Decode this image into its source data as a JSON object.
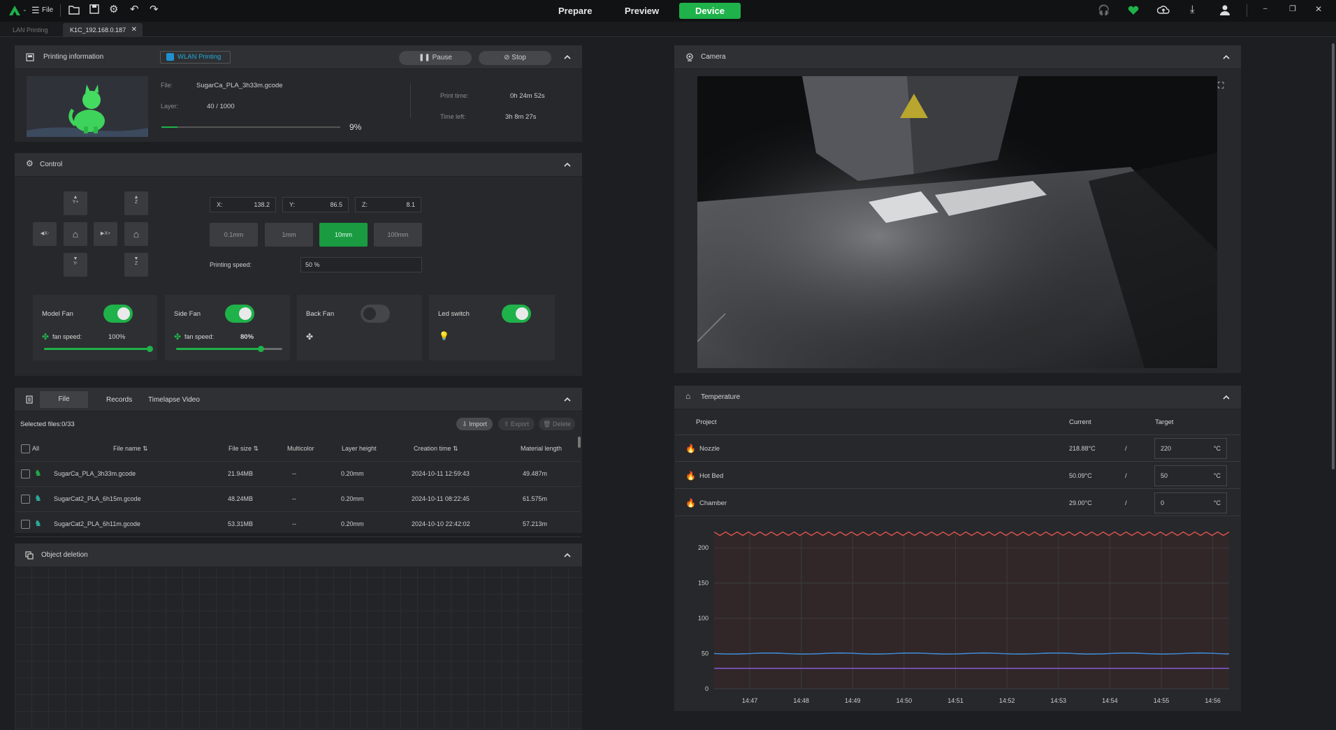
{
  "menubar": {
    "file_label": "File",
    "tabs": [
      "Prepare",
      "Preview",
      "Device"
    ],
    "active_tab": "Device"
  },
  "tabs": {
    "lan": "LAN Printing",
    "device": "K1C_192.168.0.187"
  },
  "print_info": {
    "title": "Printing information",
    "mode": "WLAN Printing",
    "pause": "Pause",
    "stop": "Stop",
    "file_label": "File:",
    "file_value": "SugarCa_PLA_3h33m.gcode",
    "layer_label": "Layer:",
    "layer_value": "40 / 1000",
    "progress": 0.09,
    "progress_text": "9%",
    "print_time_label": "Print time:",
    "print_time_value": "0h 24m 52s",
    "time_left_label": "Time left:",
    "time_left_value": "3h 8m 27s"
  },
  "control": {
    "title": "Control",
    "jog": {
      "yplus": "Y+",
      "yminus": "Y-",
      "xminus": "X-",
      "xplus": "X+",
      "zup": "Z",
      "zdown": "Z"
    },
    "x_label": "X:",
    "x_value": "138.2",
    "y_label": "Y:",
    "y_value": "86.5",
    "z_label": "Z:",
    "z_value": "8.1",
    "steps": [
      "0.1mm",
      "1mm",
      "10mm",
      "100mm"
    ],
    "active_step": "10mm",
    "speed_label": "Printing speed:",
    "speed_value": "50 %"
  },
  "fans": {
    "model_fan": {
      "label": "Model Fan",
      "on": true,
      "speed_label": "fan speed:",
      "speed": "100%",
      "level": 1.0
    },
    "side_fan": {
      "label": "Side Fan",
      "on": true,
      "speed_label": "fan speed:",
      "speed": "80%",
      "level": 0.8
    },
    "back_fan": {
      "label": "Back Fan",
      "on": false
    },
    "led": {
      "label": "Led switch",
      "on": true
    }
  },
  "files": {
    "tabs": [
      "File",
      "Records",
      "Timelapse Video"
    ],
    "active_tab": "File",
    "selected": "Selected files:0/33",
    "import": "Import",
    "export": "Export",
    "delete": "Delete",
    "columns": {
      "all": "All",
      "name": "File name",
      "size": "File size",
      "multicolor": "Multicolor",
      "layer_height": "Layer height",
      "created": "Creation time",
      "material": "Material length"
    },
    "rows": [
      {
        "name": "SugarCa_PLA_3h33m.gcode",
        "size": "21.94MB",
        "multicolor": "--",
        "layer_height": "0.20mm",
        "created": "2024-10-11 12:59:43",
        "material": "49.487m"
      },
      {
        "name": "SugarCat2_PLA_6h15m.gcode",
        "size": "48.24MB",
        "multicolor": "--",
        "layer_height": "0.20mm",
        "created": "2024-10-11 08:22:45",
        "material": "61.575m"
      },
      {
        "name": "SugarCat2_PLA_6h11m.gcode",
        "size": "53.31MB",
        "multicolor": "--",
        "layer_height": "0.20mm",
        "created": "2024-10-10 22:42:02",
        "material": "57.213m"
      }
    ]
  },
  "object_deletion": {
    "title": "Object deletion"
  },
  "camera": {
    "title": "Camera"
  },
  "temperature": {
    "title": "Temperature",
    "col_project": "Project",
    "col_current": "Current",
    "col_target": "Target",
    "rows": [
      {
        "name": "Nozzle",
        "current": "218.88°C",
        "sep": "/",
        "target": "220",
        "unit": "°C",
        "color": "#e64a4a"
      },
      {
        "name": "Hot Bed",
        "current": "50.09°C",
        "sep": "/",
        "target": "50",
        "unit": "°C",
        "color": "#3a8fe0"
      },
      {
        "name": "Chamber",
        "current": "29.00°C",
        "sep": "/",
        "target": "0",
        "unit": "°C",
        "color": "#a25be6"
      }
    ]
  },
  "chart_data": {
    "type": "line",
    "x": [
      "14:47",
      "14:48",
      "14:49",
      "14:50",
      "14:51",
      "14:52",
      "14:53",
      "14:54",
      "14:55",
      "14:56"
    ],
    "ylim": [
      0,
      220
    ],
    "yticks": [
      0,
      50,
      100,
      150,
      200
    ],
    "grid": true,
    "series": [
      {
        "name": "Nozzle",
        "values": [
          220,
          220,
          220,
          220,
          220,
          220,
          220,
          220,
          220,
          220
        ],
        "color": "#d9534f"
      },
      {
        "name": "Hot Bed",
        "values": [
          50,
          50,
          50,
          50,
          50,
          50,
          50,
          50,
          50,
          50
        ],
        "color": "#3f8fdc"
      },
      {
        "name": "Chamber",
        "values": [
          29,
          29,
          29,
          29,
          29,
          29,
          29,
          29,
          29,
          29
        ],
        "color": "#8f5ee0"
      }
    ]
  },
  "colors": {
    "accent": "#1fb14a",
    "bg": "#1d1e21",
    "panel": "#27282b"
  }
}
